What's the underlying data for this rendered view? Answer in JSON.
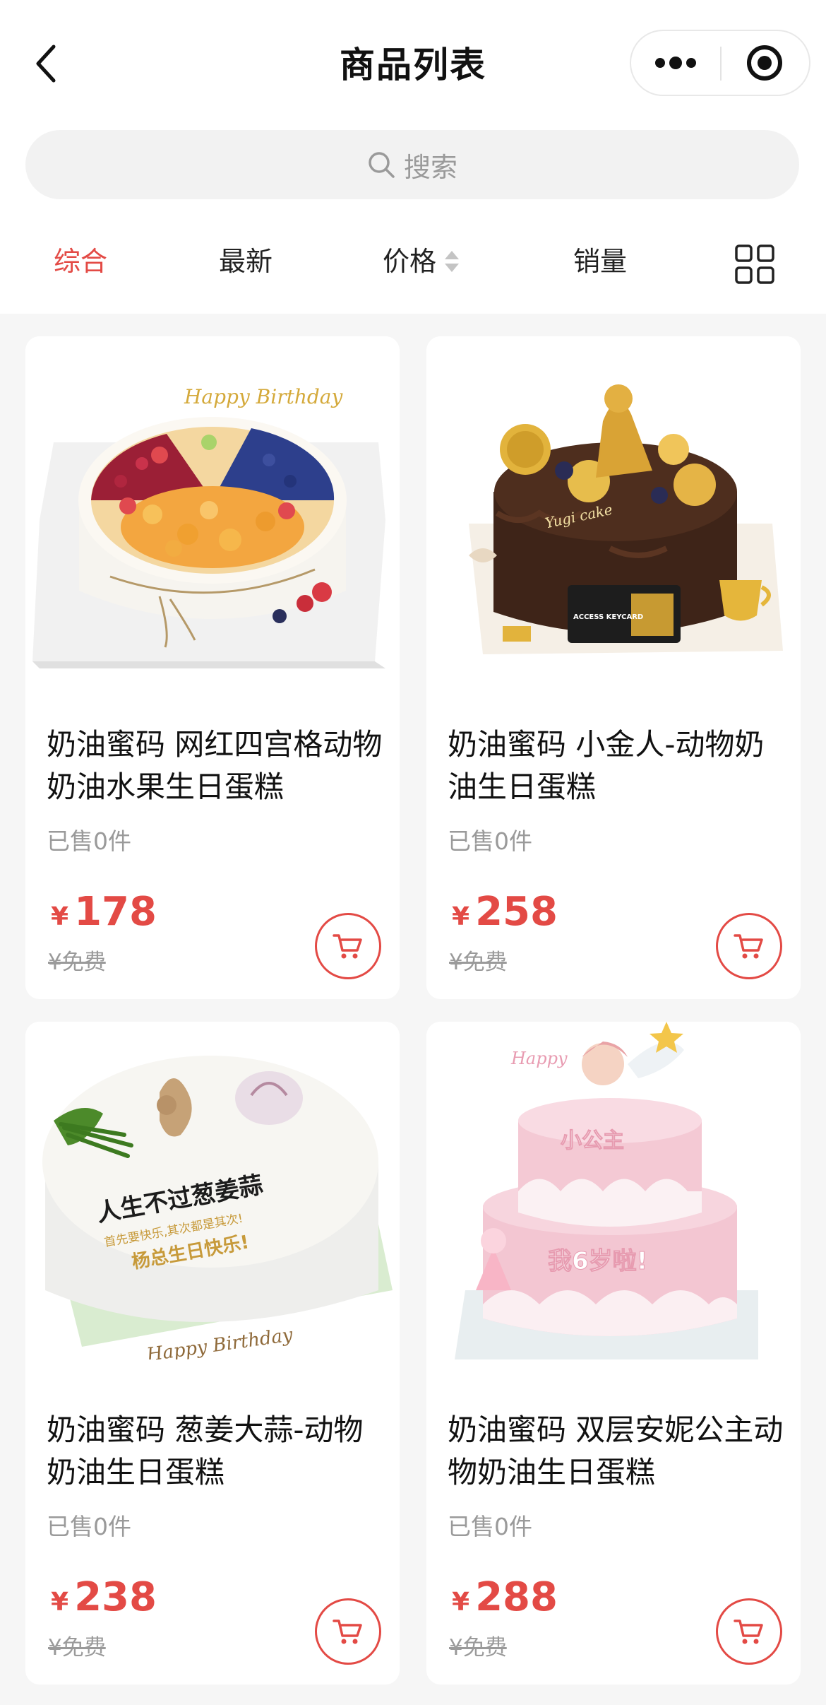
{
  "header": {
    "title": "商品列表"
  },
  "search": {
    "placeholder": "搜索"
  },
  "sort_tabs": [
    {
      "label": "综合",
      "active": true
    },
    {
      "label": "最新",
      "active": false
    },
    {
      "label": "价格",
      "active": false
    },
    {
      "label": "销量",
      "active": false
    }
  ],
  "icons": {
    "back": "chevron-left-icon",
    "more": "more-dots-icon",
    "target": "record-target-icon",
    "search": "search-icon",
    "sort": "sort-arrows-icon",
    "layout": "grid-layout-icon",
    "cart": "cart-icon"
  },
  "colors": {
    "accent": "#e34a45",
    "muted": "#9a9a9a",
    "background": "#f6f6f6"
  },
  "products": [
    {
      "name": "奶油蜜码 网红四宫格动物奶油水果生日蛋糕",
      "sold": "已售0件",
      "currency": "¥",
      "price": "178",
      "original": "¥免费",
      "image": "fruit-cake-image"
    },
    {
      "name": "奶油蜜码 小金人-动物奶油生日蛋糕",
      "sold": "已售0件",
      "currency": "¥",
      "price": "258",
      "original": "¥免费",
      "image": "gold-chocolate-cake-image"
    },
    {
      "name": "奶油蜜码 葱姜大蒜-动物奶油生日蛋糕",
      "sold": "已售0件",
      "currency": "¥",
      "price": "238",
      "original": "¥免费",
      "image": "garlic-ginger-cake-image"
    },
    {
      "name": "奶油蜜码 双层安妮公主动物奶油生日蛋糕",
      "sold": "已售0件",
      "currency": "¥",
      "price": "288",
      "original": "¥免费",
      "image": "princess-cake-image"
    }
  ],
  "image_text": {
    "cake1": "Happy Birthday",
    "cake2_top": "Yugi cake",
    "cake2_card": "ACCESS KEYCARD",
    "cake3_main": "人生不过葱姜蒜",
    "cake3_sub": "首先要快乐,其次都是其次!",
    "cake3_sign": "杨总生日快乐!",
    "cake3_rim": "Happy Birthday",
    "cake4_topper": "Happy",
    "cake4_top": "小公主",
    "cake4_bottom": "我6岁啦!"
  }
}
